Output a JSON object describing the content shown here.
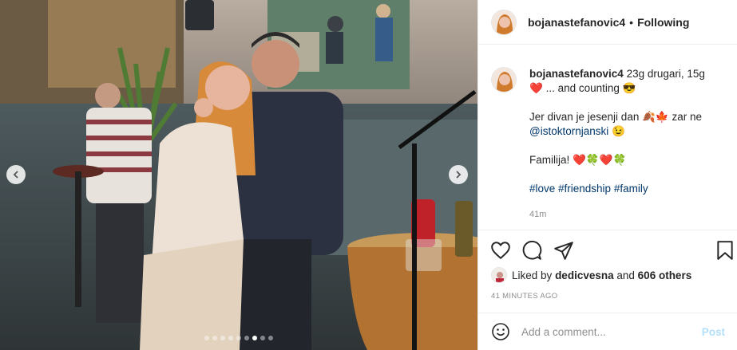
{
  "post": {
    "username": "bojanastefanovic4",
    "separator": "•",
    "follow_status": "Following",
    "caption": {
      "username": "bojanastefanovic4",
      "line1": "23g drugari, 15g",
      "line1_cont": "... and counting",
      "line2": "Jer divan je jesenji dan",
      "line2_tail": "zar ne",
      "mention": "@istoktornjanski",
      "line3": "Familija!",
      "hashtags": "#love #friendship #family"
    },
    "time_short": "41m",
    "likes": {
      "prefix": "Liked by",
      "user": "dedicvesna",
      "and": "and",
      "others": "606 others"
    },
    "time_ago": "41 MINUTES AGO",
    "comment_placeholder": "Add a comment...",
    "post_label": "Post"
  },
  "carousel": {
    "total": 9,
    "active_index": 6
  },
  "icons": {
    "prev": "chevron-left-icon",
    "next": "chevron-right-icon",
    "like": "heart-icon",
    "comment": "comment-icon",
    "share": "paper-plane-icon",
    "save": "bookmark-icon",
    "emoji": "smiley-icon"
  },
  "colors": {
    "link": "#00376b",
    "muted": "#8e8e8e",
    "post_disabled": "#b2dffc",
    "heart": "#ed4956"
  }
}
